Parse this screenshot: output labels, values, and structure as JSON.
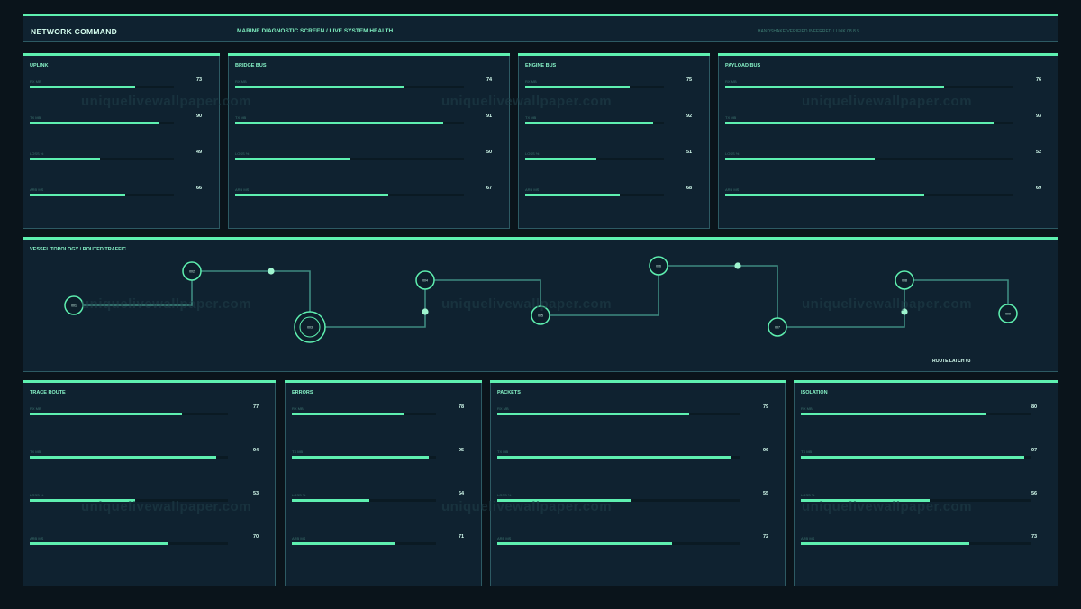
{
  "header": {
    "title": "NETWORK COMMAND",
    "subtitle": "MARINE DIAGNOSTIC SCREEN / LIVE SYSTEM HEALTH",
    "status": "HANDSHAKE VERIFIED INFERRED / LINK 08.8.5"
  },
  "metric_labels": [
    "RX MB",
    "TX MB",
    "LOSS %",
    "ARB MS"
  ],
  "panels_top": [
    {
      "title": "UPLINK",
      "values": [
        73,
        90,
        49,
        66
      ]
    },
    {
      "title": "BRIDGE BUS",
      "values": [
        74,
        91,
        50,
        67
      ]
    },
    {
      "title": "ENGINE BUS",
      "values": [
        75,
        92,
        51,
        68
      ]
    },
    {
      "title": "PAYLOAD BUS",
      "values": [
        76,
        93,
        52,
        69
      ]
    }
  ],
  "panels_bottom": [
    {
      "title": "TRACE ROUTE",
      "values": [
        77,
        94,
        53,
        70
      ]
    },
    {
      "title": "ERRORS",
      "values": [
        78,
        95,
        54,
        71
      ]
    },
    {
      "title": "PACKETS",
      "values": [
        79,
        96,
        55,
        72
      ]
    },
    {
      "title": "ISOLATION",
      "values": [
        80,
        97,
        56,
        73
      ]
    }
  ],
  "topology": {
    "title": "VESSEL TOPOLOGY / ROUTED TRAFFIC",
    "nodes": [
      "001",
      "002",
      "003",
      "004",
      "005",
      "006",
      "007",
      "008",
      "009"
    ],
    "route_latch": "ROUTE LATCH 03"
  },
  "watermark": "uniquelivewallpaper.com",
  "colors": {
    "accent": "#5ef0b0",
    "panel": "#0f2230",
    "background": "#0a141b",
    "link": "#3e8a80"
  }
}
